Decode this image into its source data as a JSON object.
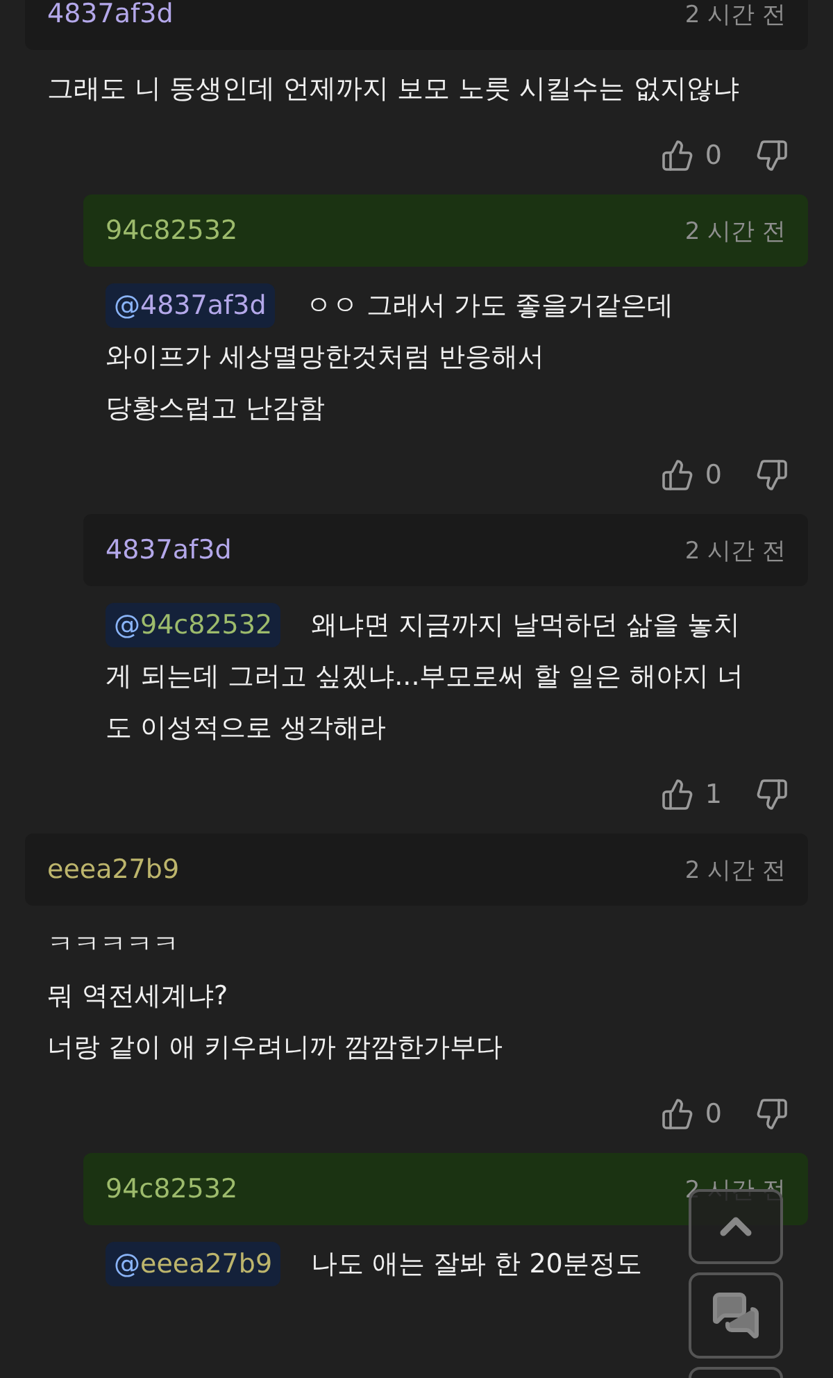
{
  "comments": [
    {
      "author": {
        "name": "4837af3d",
        "color": "#b4a8ea"
      },
      "op": false,
      "time": "2 시간 전",
      "lines": [
        "그래도 니 동생인데 언제까지 보모 노릇 시킬수는 없지않냐"
      ],
      "likes": "0",
      "children": [
        {
          "author": {
            "name": "94c82532",
            "color": "#9dbb6c"
          },
          "op": true,
          "time": "2 시간 전",
          "mention": {
            "name": "@4837af3d",
            "color": "#b4a8ea"
          },
          "lines": [
            "ㅇㅇ 그래서 가도 좋을거같은데",
            "와이프가 세상멸망한것처럼 반응해서",
            "당황스럽고 난감함"
          ],
          "likes": "0"
        },
        {
          "author": {
            "name": "4837af3d",
            "color": "#b4a8ea"
          },
          "op": false,
          "time": "2 시간 전",
          "mention": {
            "name": "@94c82532",
            "color": "#9dbb6c"
          },
          "lines": [
            "왜냐면 지금까지 날먹하던 삶을 놓치",
            "게 되는데 그러고 싶겠냐...부모로써 할 일은 해야지 너",
            "도 이성적으로 생각해라"
          ],
          "likes": "1"
        }
      ]
    },
    {
      "author": {
        "name": "eeea27b9",
        "color": "#bdb56c"
      },
      "op": false,
      "time": "2 시간 전",
      "lines": [
        "ㅋㅋㅋㅋㅋ",
        "뭐 역전세계냐?",
        "너랑 같이 애 키우려니까 깜깜한가부다"
      ],
      "likes": "0",
      "children": [
        {
          "author": {
            "name": "94c82532",
            "color": "#9dbb6c"
          },
          "op": true,
          "time": "2 시간 전",
          "mention": {
            "name": "@eeea27b9",
            "color": "#bdb56c"
          },
          "lines": [
            "나도 애는 잘봐 한 20분정도"
          ]
        }
      ]
    }
  ]
}
